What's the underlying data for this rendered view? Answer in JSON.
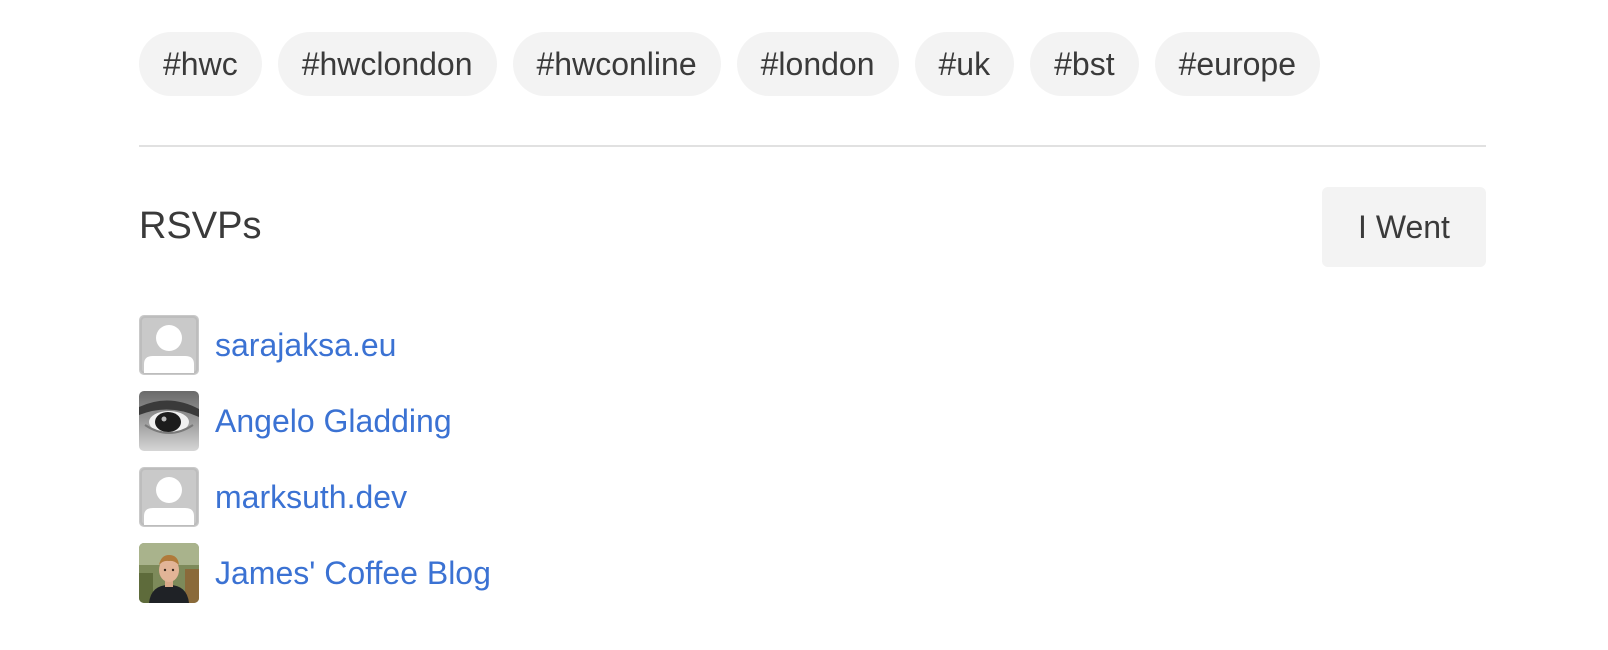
{
  "tags": [
    "#hwc",
    "#hwclondon",
    "#hwconline",
    "#london",
    "#uk",
    "#bst",
    "#europe"
  ],
  "rsvp": {
    "title": "RSVPs",
    "button_label": "I Went",
    "items": [
      {
        "name": "sarajaksa.eu",
        "avatar": "default-user-icon"
      },
      {
        "name": "Angelo Gladding",
        "avatar": "eye-photo-avatar"
      },
      {
        "name": "marksuth.dev",
        "avatar": "default-user-icon"
      },
      {
        "name": "James' Coffee Blog",
        "avatar": "person-photo-avatar"
      }
    ]
  },
  "colors": {
    "link": "#3b72d3",
    "chip_bg": "#f3f3f3",
    "text": "#3a3a3a",
    "divider": "#e1e1e1"
  }
}
